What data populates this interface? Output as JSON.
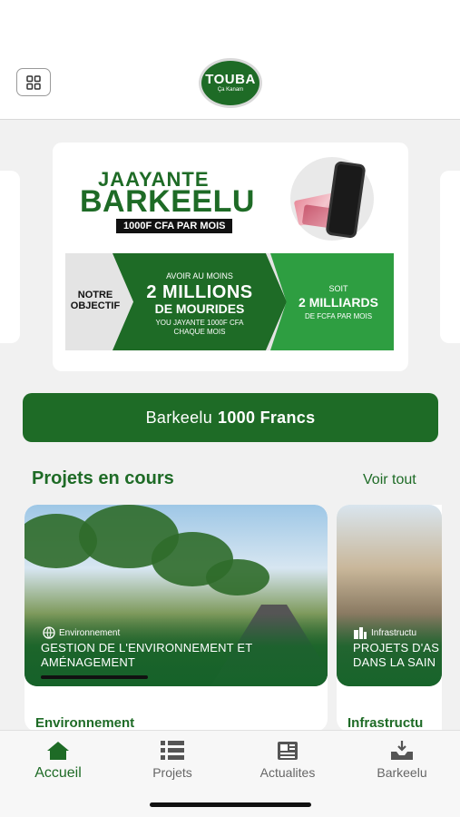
{
  "header": {
    "menu_icon": "grid-icon",
    "logo_line1": "TOUBA",
    "logo_line2": "Ça Kanam"
  },
  "banner": {
    "title_line1": "JAAYANTE",
    "title_line2": "BARKEELU",
    "pill": "1000F CFA PAR MOIS",
    "goal_label": "NOTRE OBJECTIF",
    "mid_line1": "AVOIR AU MOINS",
    "mid_line2": "2 MILLIONS",
    "mid_line3": "DE MOURIDES",
    "mid_line4": "YOU JAYANTE 1000F CFA CHAQUE MOIS",
    "right_line1": "SOIT",
    "right_line2": "2 MILLIARDS",
    "right_line3": "DE FCFA PAR MOIS"
  },
  "cta": {
    "label_prefix": "Barkeelu",
    "label_bold": "1000 Francs"
  },
  "section": {
    "title": "Projets en cours",
    "see_all": "Voir tout"
  },
  "projects": [
    {
      "category_tag": "Environnement",
      "title": "GESTION DE L'ENVIRONNEMENT ET AMÉNAGEMENT",
      "category": "Environnement"
    },
    {
      "category_tag": "Infrastructu",
      "title": "PROJETS D'AS DANS LA SAIN",
      "category": "Infrastructu"
    }
  ],
  "tabs": [
    {
      "label": "Accueil",
      "icon": "home-icon",
      "active": true
    },
    {
      "label": "Projets",
      "icon": "list-icon",
      "active": false
    },
    {
      "label": "Actualites",
      "icon": "newspaper-icon",
      "active": false
    },
    {
      "label": "Barkeelu",
      "icon": "donate-icon",
      "active": false
    }
  ],
  "colors": {
    "primary": "#1e6b26",
    "accent": "#2e9e41",
    "background": "#f1f1f1"
  }
}
